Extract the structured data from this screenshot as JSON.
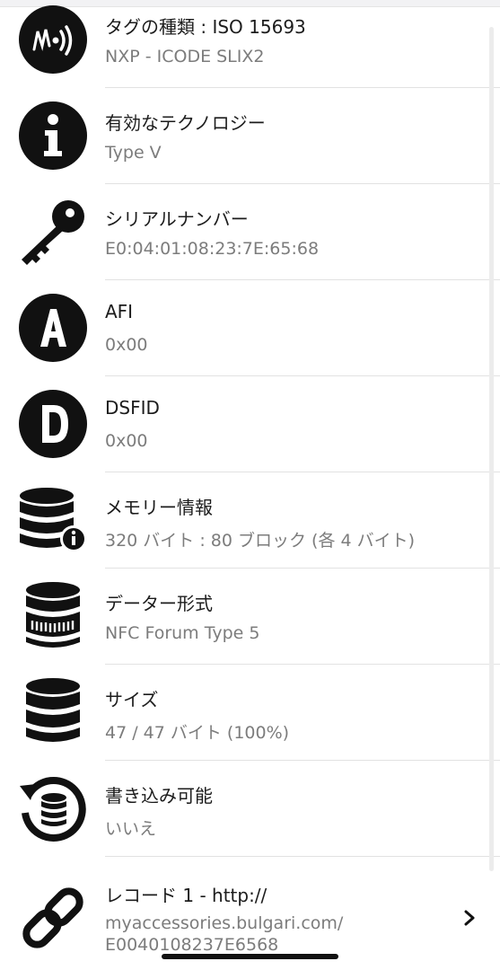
{
  "rows": [
    {
      "icon": "nfc-tag-icon",
      "title": "タグの種類 : ISO 15693",
      "subtitle": "NXP - ICODE SLIX2"
    },
    {
      "icon": "info-icon",
      "title": "有効なテクノロジー",
      "subtitle": "Type V"
    },
    {
      "icon": "key-icon",
      "title": "シリアルナンバー",
      "subtitle": "E0:04:01:08:23:7E:65:68"
    },
    {
      "icon": "letter-a-icon",
      "title": "AFI",
      "subtitle": "0x00"
    },
    {
      "icon": "letter-d-icon",
      "title": "DSFID",
      "subtitle": "0x00"
    },
    {
      "icon": "database-info-icon",
      "title": "メモリー情報",
      "subtitle": "320 バイト : 80 ブロック (各 4 バイト)"
    },
    {
      "icon": "database-format-icon",
      "title": "データー形式",
      "subtitle": "NFC Forum Type 5"
    },
    {
      "icon": "database-icon",
      "title": "サイズ",
      "subtitle": "47 / 47 バイト (100%)"
    },
    {
      "icon": "writable-icon",
      "title": "書き込み可能",
      "subtitle": "いいえ"
    },
    {
      "icon": "link-icon",
      "title": "レコード 1 - http://",
      "subtitle": "myaccessories.bulgari.com/",
      "subtitle2": "E0040108237E6568"
    }
  ],
  "chevron_icon": "chevron-right-icon"
}
